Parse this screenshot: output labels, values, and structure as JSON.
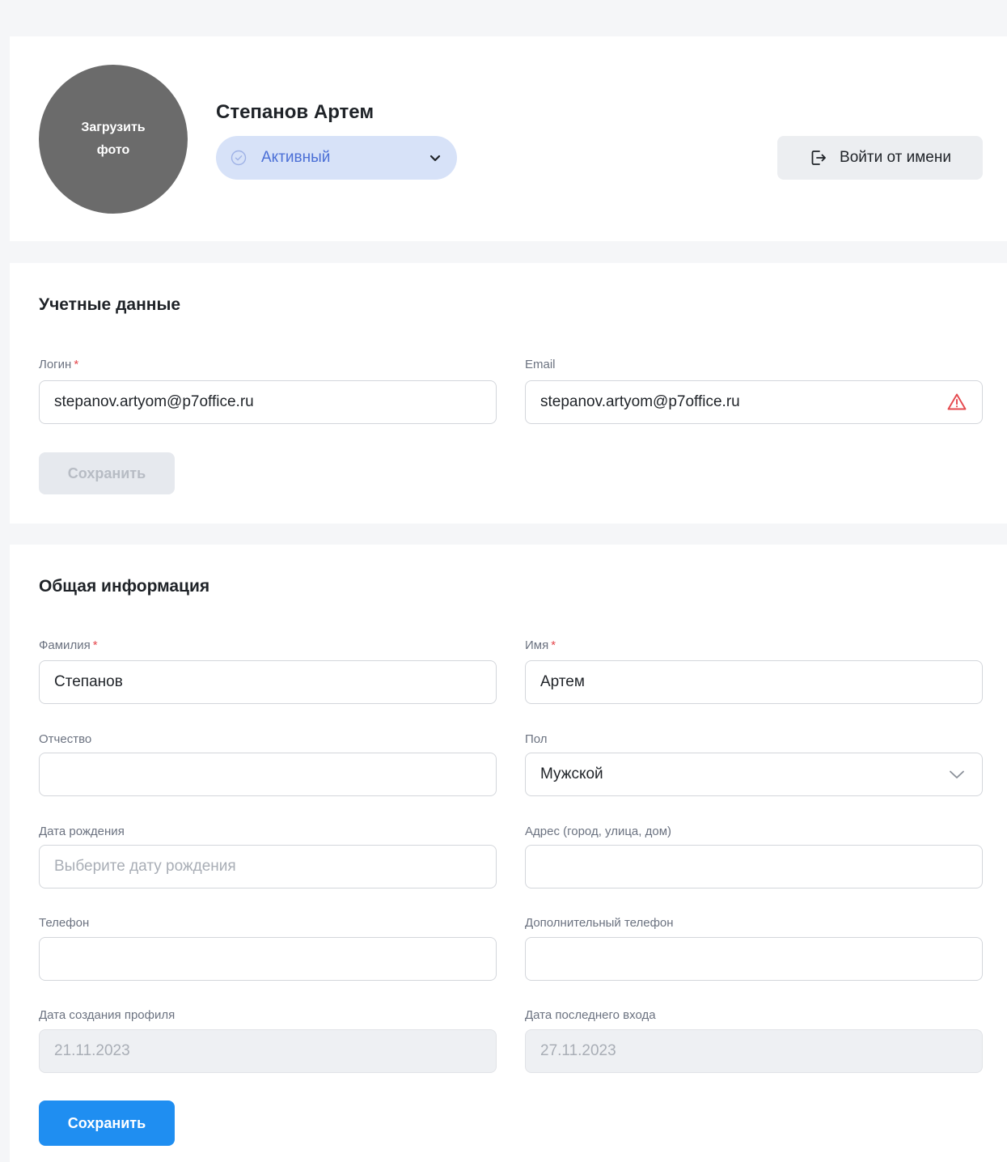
{
  "profile": {
    "avatar_upload_label": "Загрузить фото",
    "name": "Степанов Артем",
    "status": {
      "value": "Активный",
      "options": [
        "Активный"
      ]
    },
    "login_as_label": "Войти от имени"
  },
  "account": {
    "title": "Учетные данные",
    "login": {
      "label": "Логин",
      "required_mark": "*",
      "value": "stepanov.artyom@p7office.ru"
    },
    "email": {
      "label": "Email",
      "value": "stepanov.artyom@p7office.ru",
      "status_icon": "warning-icon"
    },
    "save_label": "Сохранить"
  },
  "general": {
    "title": "Общая информация",
    "last_name": {
      "label": "Фамилия",
      "required_mark": "*",
      "value": "Степанов"
    },
    "first_name": {
      "label": "Имя",
      "required_mark": "*",
      "value": "Артем"
    },
    "patronymic": {
      "label": "Отчество",
      "value": ""
    },
    "gender": {
      "label": "Пол",
      "value": "Мужской"
    },
    "birth_date": {
      "label": "Дата рождения",
      "placeholder": "Выберите дату рождения",
      "value": ""
    },
    "address": {
      "label": "Адрес (город, улица, дом)",
      "value": ""
    },
    "phone": {
      "label": "Телефон",
      "value": ""
    },
    "extra_phone": {
      "label": "Дополнительный телефон",
      "value": ""
    },
    "created_date": {
      "label": "Дата создания профиля",
      "value": "21.11.2023"
    },
    "last_login_date": {
      "label": "Дата последнего входа",
      "value": "27.11.2023"
    },
    "save_label": "Сохранить"
  },
  "colors": {
    "page_bg": "#f5f6f8",
    "accent": "#1f8ef1",
    "status_bg": "#d7e2f8",
    "status_text": "#4b6fd6",
    "required": "#e5484d",
    "warning": "#e5484d"
  }
}
